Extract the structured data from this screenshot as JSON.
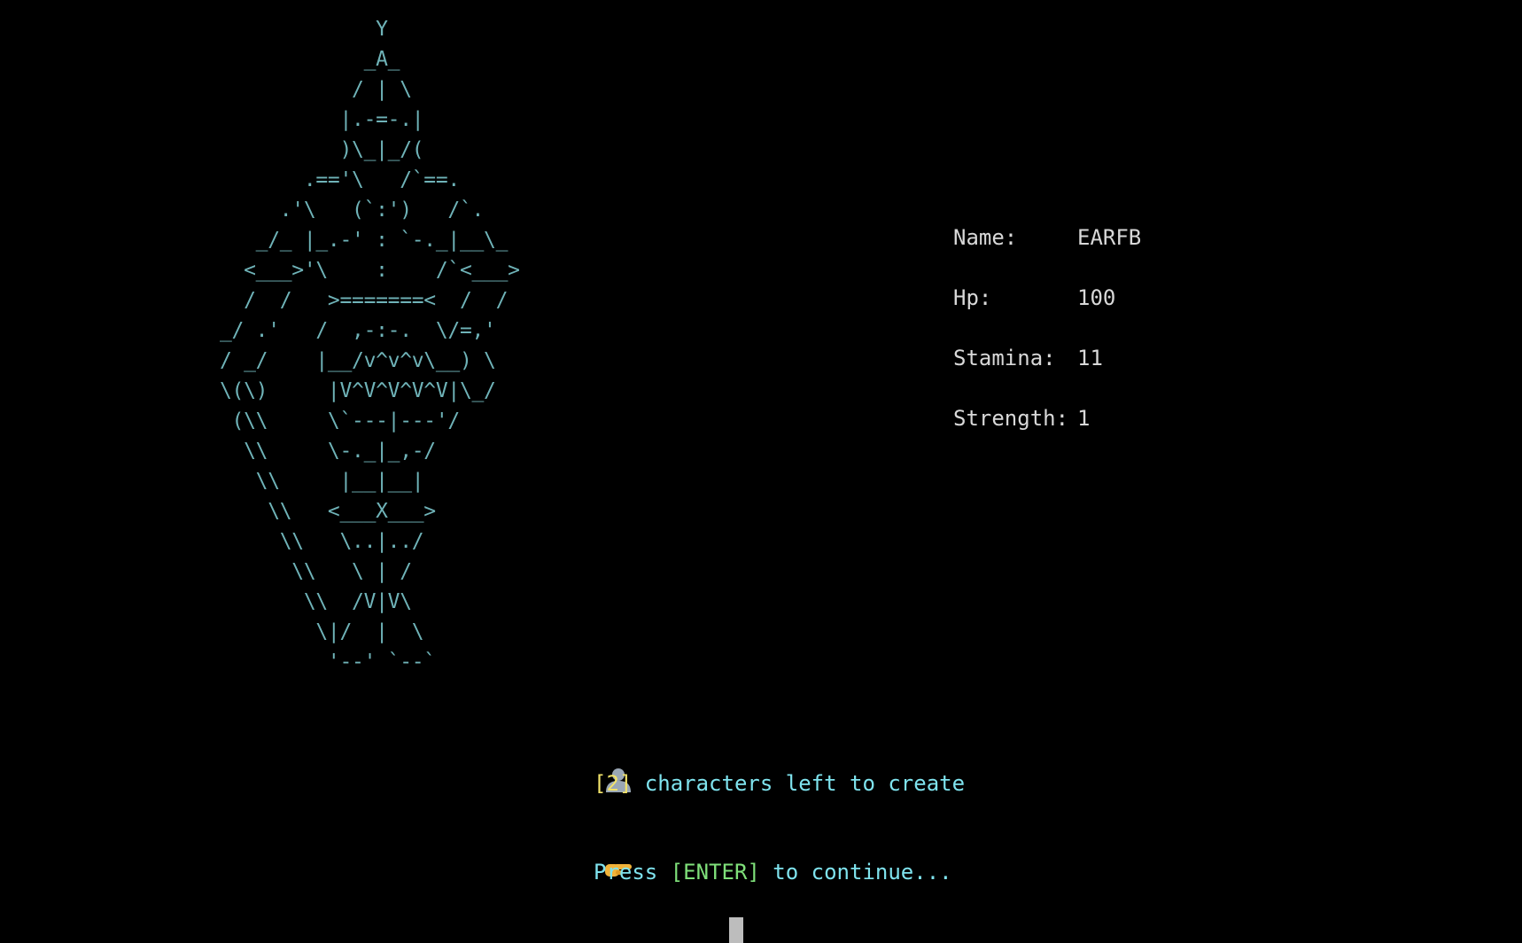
{
  "ascii_art": "             Y\n            _A_\n           / | \\\n          |.-=-.|\n          )\\_|_/(\n       .=='\\   /`==.\n     .'\\   (`:')   /`.\n   _/_ |_.-' : `-._|__\\_\n  <___>'\\    :    /`<___>\n  /  /   >=======<  /  /\n_/ .'   /  ,-:-.  \\/=,'\n/ _/    |__/v^v^v\\__) \\\n\\(\\)     |V^V^V^V^V|\\_/\n (\\\\     \\`---|---'/\n  \\\\     \\-._|_,-/\n   \\\\     |__|__|\n    \\\\   <___X___>\n     \\\\   \\..|../\n      \\\\   \\ | /\n       \\\\  /V|V\\\n        \\|/  |  \\\n         '--' `--`",
  "stats": {
    "name_label": "Name:",
    "name_value": "EARFB",
    "hp_label": "Hp:",
    "hp_value": "100",
    "stamina_label": "Stamina:",
    "stamina_value": "11",
    "strength_label": "Strength:",
    "strength_value": "1"
  },
  "messages": {
    "characters_left_icon": "person-silhouette-icon",
    "characters_left_count": "[2]",
    "characters_left_text": " characters left to create",
    "continue_icon": "pointing-hand-icon",
    "continue_prefix": "Press ",
    "continue_key": "[ENTER]",
    "continue_suffix": " to continue..."
  },
  "colors": {
    "art": "#6fb3b8",
    "text": "#d8d8d8",
    "message": "#7fe3ee",
    "count": "#f2e36a",
    "key": "#7fe07a",
    "background": "#000000"
  }
}
